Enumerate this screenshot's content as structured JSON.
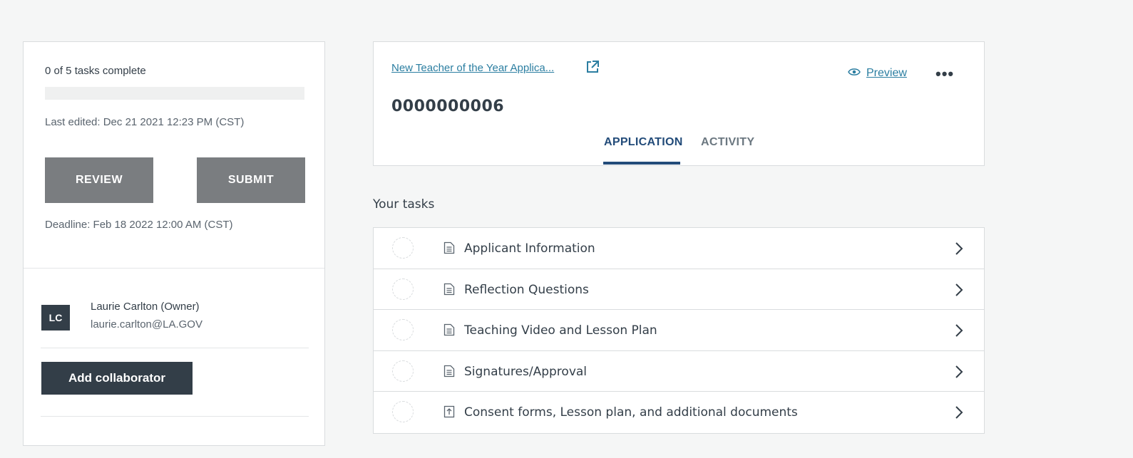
{
  "summary": {
    "progress_text": "0 of 5 tasks complete",
    "progress_fraction": 0,
    "last_edited": "Last edited: Dec 21 2021 12:23 PM (CST)",
    "review_label": "REVIEW",
    "submit_label": "SUBMIT",
    "deadline": "Deadline: Feb 18 2022 12:00 AM (CST)",
    "owner": {
      "initials": "LC",
      "name": "Laurie Carlton (Owner)",
      "email": "laurie.carlton@LA.GOV"
    },
    "add_collaborator_label": "Add collaborator"
  },
  "application": {
    "title": "New Teacher of the Year Applica...",
    "id": "0000000006",
    "preview_label": "Preview",
    "more_label": "•••",
    "tabs": [
      {
        "label": "APPLICATION",
        "active": true
      },
      {
        "label": "ACTIVITY",
        "active": false
      }
    ]
  },
  "tasks": {
    "heading": "Your tasks",
    "items": [
      {
        "label": "Applicant Information",
        "icon": "document-icon"
      },
      {
        "label": "Reflection Questions",
        "icon": "document-icon"
      },
      {
        "label": "Teaching Video and Lesson Plan",
        "icon": "document-icon"
      },
      {
        "label": "Signatures/Approval",
        "icon": "document-icon"
      },
      {
        "label": "Consent forms, Lesson plan, and additional documents",
        "icon": "upload-icon"
      }
    ]
  },
  "colors": {
    "accent_blue": "#224b79",
    "link_blue": "#2b7ea1",
    "dark_button": "#333e48",
    "gray_button": "#7a7d80"
  }
}
